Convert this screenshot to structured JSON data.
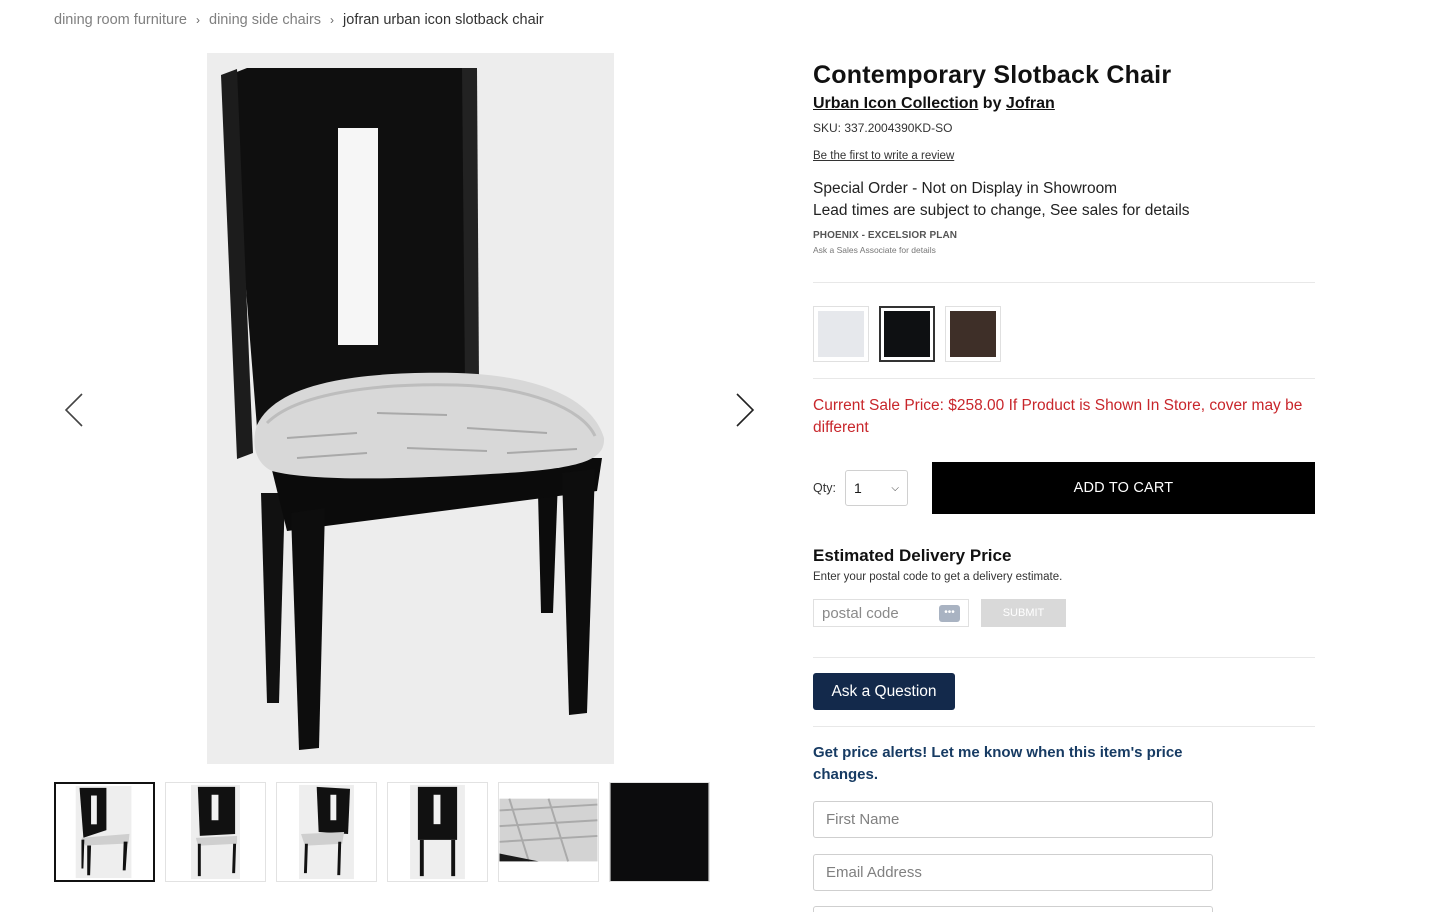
{
  "breadcrumb": {
    "items": [
      "dining room furniture",
      "dining side chairs"
    ],
    "current": "jofran urban icon slotback chair",
    "separator": "›"
  },
  "product": {
    "title": "Contemporary Slotback Chair",
    "collection": "Urban Icon Collection",
    "by": "by",
    "brand": "Jofran",
    "sku": "SKU: 337.2004390KD-SO",
    "review_link": "Be the first to write a review",
    "special_order": "Special Order - Not on Display in Showroom",
    "lead_times": "Lead times are subject to change, See sales for details",
    "plan_name": "PHOENIX - EXCELSIOR PLAN",
    "plan_sub": "Ask a Sales Associate for details"
  },
  "swatches": [
    {
      "name": "light-gray",
      "color": "#e6e8ec",
      "selected": false
    },
    {
      "name": "black",
      "color": "#0e1012",
      "selected": true
    },
    {
      "name": "espresso",
      "color": "#3e2f28",
      "selected": false
    }
  ],
  "sale_price": "Current Sale Price: $258.00 If Product is Shown In Store, cover may be different",
  "quantity": {
    "label": "Qty:",
    "value": "1"
  },
  "add_to_cart": "ADD TO CART",
  "delivery": {
    "title": "Estimated Delivery Price",
    "hint": "Enter your postal code to get a delivery estimate.",
    "postal_placeholder": "postal code",
    "submit": "SUBMIT"
  },
  "ask_question": "Ask a Question",
  "price_alerts": {
    "heading": "Get price alerts! Let me know when this item's price changes.",
    "first_name_placeholder": "First Name",
    "email_placeholder": "Email Address"
  },
  "gallery": {
    "thumbnails": [
      "front",
      "front-angle",
      "angle",
      "back",
      "seat-detail",
      "finish-detail"
    ],
    "active_index": 0
  },
  "colors": {
    "sale_price": "#c8262b",
    "ask_button": "#13294b",
    "alerts_heading": "#173b63",
    "add_to_cart": "#000000"
  }
}
